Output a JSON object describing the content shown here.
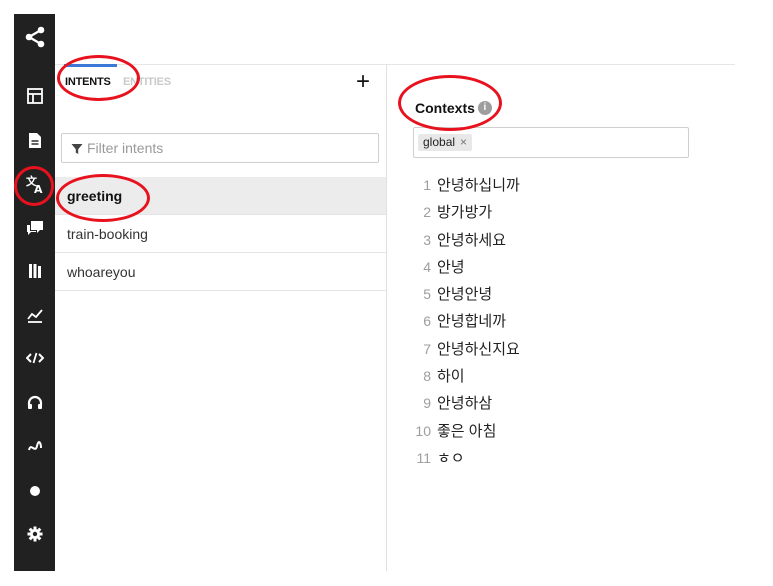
{
  "sidebar": {
    "icons": [
      "share-icon",
      "dashboard-icon",
      "document-icon",
      "translate-icon",
      "feedback-icon",
      "library-icon",
      "chart-icon",
      "code-icon",
      "headset-icon",
      "route-icon",
      "dot-icon",
      "gear-icon"
    ]
  },
  "intents_panel": {
    "tabs": [
      {
        "label": "INTENTS"
      },
      {
        "label": "ENTITIES"
      }
    ],
    "add_label": "+",
    "filter_placeholder": "Filter intents",
    "items": [
      {
        "label": "greeting"
      },
      {
        "label": "train-booking"
      },
      {
        "label": "whoareyou"
      }
    ],
    "active_item": "greeting"
  },
  "editor": {
    "contexts_label": "Contexts",
    "info_glyph": "i",
    "context_chip": "global",
    "chip_remove": "×",
    "utterances": [
      {
        "n": "1",
        "text": "안녕하십니까"
      },
      {
        "n": "2",
        "text": "방가방가"
      },
      {
        "n": "3",
        "text": "안녕하세요"
      },
      {
        "n": "4",
        "text": "안녕"
      },
      {
        "n": "5",
        "text": "안녕안녕"
      },
      {
        "n": "6",
        "text": "안녕합네까"
      },
      {
        "n": "7",
        "text": "안녕하신지요"
      },
      {
        "n": "8",
        "text": "하이"
      },
      {
        "n": "9",
        "text": "안녕하삼"
      },
      {
        "n": "10",
        "text": "좋은 아침"
      },
      {
        "n": "11",
        "text": "ㅎㅇ"
      }
    ]
  },
  "colors": {
    "sidebar_bg": "#212121",
    "accent": "#3c78d8",
    "annotation": "#e8121e",
    "active_row": "#ececec"
  }
}
